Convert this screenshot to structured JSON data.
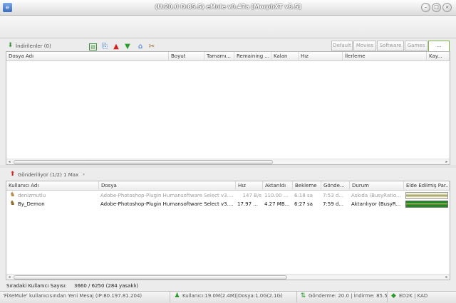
{
  "window": {
    "title": "(U:20.0 D:85.5) eMule v0.47a [MorphXT v8.5]",
    "minimize_glyph": "–",
    "maximize_glyph": "□",
    "close_glyph": "×"
  },
  "downloads": {
    "section_label": "İndirilenler (0)",
    "category_tabs": [
      "Default",
      "Movies",
      "Software",
      "Games",
      "..."
    ],
    "columns": [
      "Dosya Adı",
      "Boyut",
      "Tamamı...",
      "Remaining ...",
      "Kalan",
      "Hız",
      "İlerleme",
      "Kay..."
    ]
  },
  "uploads": {
    "section_label": "Gönderiliyor (1/2) 1 Max",
    "columns": [
      "Kullanıcı Adı",
      "Dosya",
      "Hız",
      "Aktarıldı",
      "Bekleme",
      "Gönde...",
      "Durum",
      "Elde Edilmiş Par..."
    ],
    "rows": [
      {
        "user": "denizmutlu",
        "file": "Adobe-Photoshop-Plugin Humansoftware Select v3....",
        "speed": "147 B/s",
        "transferred": "110.00 ...",
        "wait": "6:18 sa",
        "upload_time": "7:53 d...",
        "status": "Askıda (BusyRatio..."
      },
      {
        "user": "By_Demon",
        "file": "Adobe-Photoshop-Plugin Humansoftware Select v3....",
        "speed": "17.97 ...",
        "transferred": "4.27 MB...",
        "wait": "6:27 sa",
        "upload_time": "7:59 d...",
        "status": "Aktarılıyor (BusyR..."
      }
    ]
  },
  "queue": {
    "label": "Sıradaki Kullanıcı Sayısı:",
    "value": "3660 / 6250 (284 yasaklı)"
  },
  "statusbar": {
    "message": "'FiXeMule' kullanıcısından Yeni Mesaj (IP:80.197.81.204)",
    "users": "Kullanıcı:19.0M(2.4M)|Dosya:1.0G(2.1G)",
    "transfer": "Gönderme: 20.0 | İndirme: 85.5",
    "network": "ED2K | KAD"
  },
  "colors": {
    "progress_green": "#1f8a1f",
    "progress_olive": "#8c8a3a",
    "active_tab_border": "#7fb24a"
  }
}
